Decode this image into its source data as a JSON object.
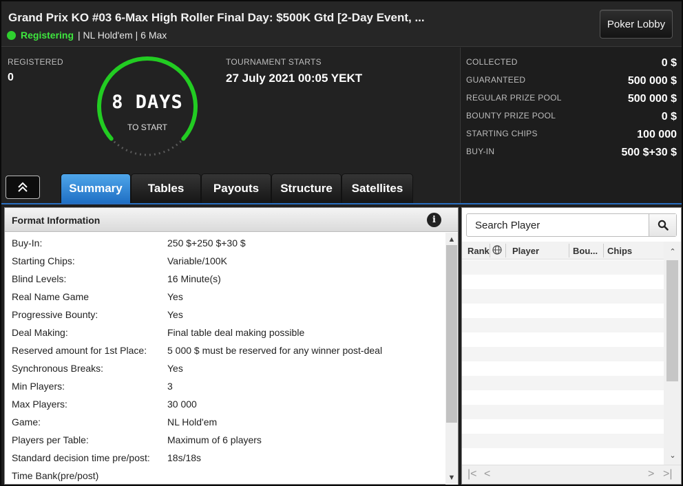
{
  "header": {
    "title": "Grand Prix KO #03 6-Max High Roller Final Day: $500K Gtd [2-Day Event, ...",
    "status": "Registering",
    "game_info": "| NL Hold'em | 6 Max",
    "lobby_button": "Poker Lobby"
  },
  "info": {
    "registered_label": "REGISTERED",
    "registered_value": "0",
    "countdown_value": "8 DAYS",
    "countdown_sub": "TO START",
    "starts_label": "TOURNAMENT STARTS",
    "starts_value": "27 July 2021  00:05 YEKT"
  },
  "prize": [
    {
      "label": "COLLECTED",
      "value": "0 $"
    },
    {
      "label": "GUARANTEED",
      "value": "500 000 $"
    },
    {
      "label": "REGULAR PRIZE POOL",
      "value": "500 000 $"
    },
    {
      "label": "BOUNTY PRIZE POOL",
      "value": "0 $"
    },
    {
      "label": "STARTING CHIPS",
      "value": "100 000"
    },
    {
      "label": "BUY-IN",
      "value": "500 $+30 $"
    }
  ],
  "tabs": [
    "Summary",
    "Tables",
    "Payouts",
    "Structure",
    "Satellites"
  ],
  "active_tab": "Summary",
  "format": {
    "title": "Format Information",
    "rows": [
      {
        "k": "Buy-In:",
        "v": "250 $+250 $+30 $"
      },
      {
        "k": "Starting Chips:",
        "v": "Variable/100K"
      },
      {
        "k": "Blind Levels:",
        "v": "16 Minute(s)"
      },
      {
        "k": "Real Name Game",
        "v": "Yes"
      },
      {
        "k": "Progressive Bounty:",
        "v": "Yes"
      },
      {
        "k": "Deal Making:",
        "v": "Final table deal making possible"
      },
      {
        "k": "Reserved amount for 1st Place:",
        "v": "5 000 $ must be reserved for any winner post-deal"
      },
      {
        "k": "Synchronous Breaks:",
        "v": "Yes"
      },
      {
        "k": "Min Players:",
        "v": "3"
      },
      {
        "k": "Max Players:",
        "v": "30 000"
      },
      {
        "k": "Game:",
        "v": "NL Hold'em"
      },
      {
        "k": "Players per Table:",
        "v": "Maximum of 6 players"
      },
      {
        "k": "Standard decision time pre/post:",
        "v": "18s/18s"
      },
      {
        "k": "Time Bank(pre/post)",
        "v": ""
      }
    ]
  },
  "players": {
    "search_placeholder": "Search Player",
    "columns": {
      "rank": "Rank",
      "player": "Player",
      "bounty": "Bou...",
      "chips": "Chips"
    }
  },
  "colors": {
    "accent": "#1f6fc4",
    "status": "#3ee63e",
    "ring": "#22cc22"
  },
  "icons": {
    "info": "info-icon",
    "search": "search-icon",
    "expand": "double-chevron-up-icon",
    "globe": "globe-icon"
  }
}
